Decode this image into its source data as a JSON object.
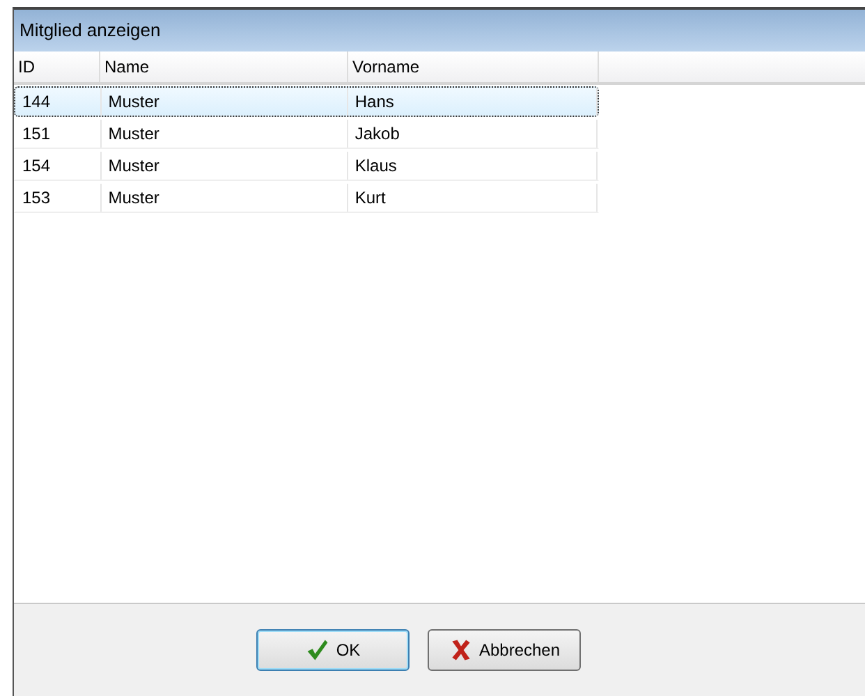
{
  "window": {
    "title": "Mitglied anzeigen"
  },
  "table": {
    "columns": [
      "ID",
      "Name",
      "Vorname"
    ],
    "rows": [
      {
        "cells": [
          "144",
          "Muster",
          "Hans"
        ],
        "selected": true
      },
      {
        "cells": [
          "151",
          "Muster",
          "Jakob"
        ],
        "selected": false
      },
      {
        "cells": [
          "154",
          "Muster",
          "Klaus"
        ],
        "selected": false
      },
      {
        "cells": [
          "153",
          "Muster",
          "Kurt"
        ],
        "selected": false
      }
    ]
  },
  "buttons": [
    {
      "kind": "ok",
      "label": "OK"
    },
    {
      "kind": "cancel",
      "label": "Abbrechen"
    }
  ]
}
